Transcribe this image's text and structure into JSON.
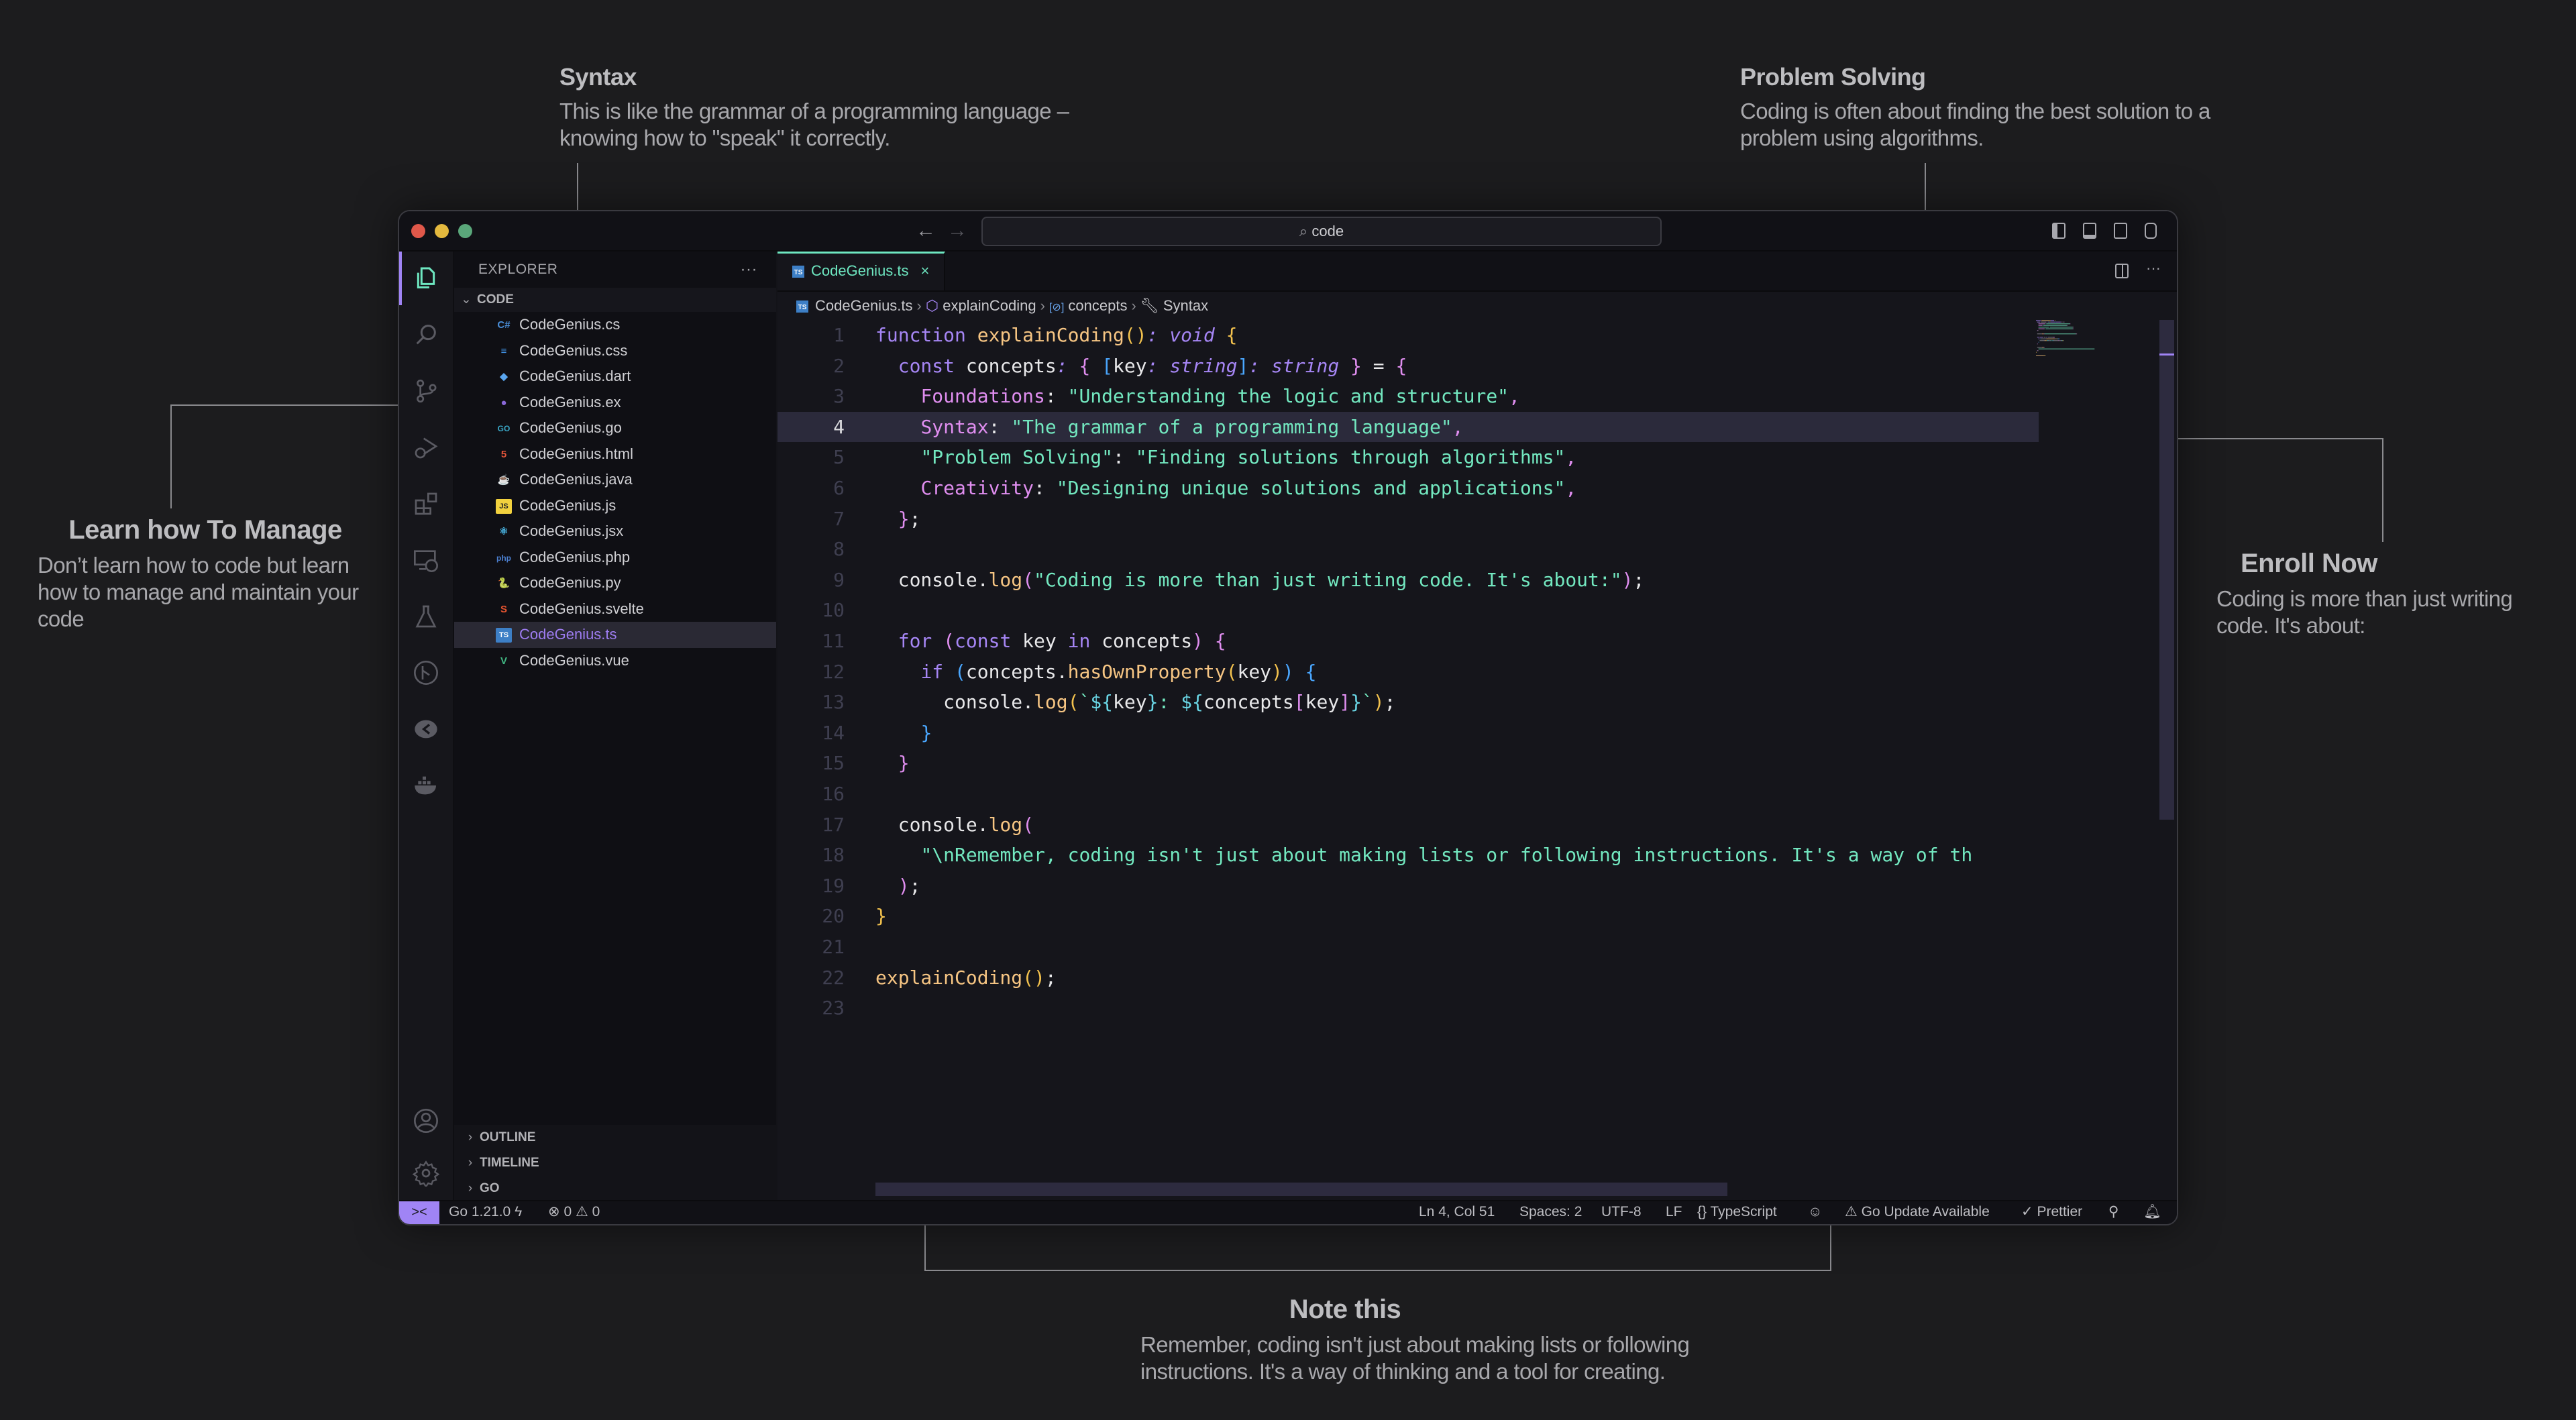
{
  "annotations": {
    "syntax": {
      "title": "Syntax",
      "body_line1": "This is like the grammar of a programming language –",
      "body_line2": "knowing how to \"speak\" it correctly."
    },
    "problem_solving": {
      "title": "Problem Solving",
      "body_line1": "Coding is often about finding the best solution to a",
      "body_line2": "problem using algorithms."
    },
    "learn": {
      "title": "Learn how To Manage",
      "body_line1": "Don’t learn how to code but learn",
      "body_line2": "how to manage and maintain your",
      "body_line3": "code"
    },
    "enroll": {
      "title": "Enroll Now",
      "body_line1": "Coding is more than just writing",
      "body_line2": "code. It's about:"
    },
    "note": {
      "title": "Note this",
      "body_line1": "Remember, coding isn't just about making lists or following",
      "body_line2": "instructions. It's a way of thinking and a tool for creating."
    }
  },
  "titlebar": {
    "search_text": "code",
    "search_icon": "search-icon",
    "back_icon": "arrow-left-icon",
    "forward_icon": "arrow-right-icon",
    "layout_icons": [
      "toggle-primary-sidebar-icon",
      "toggle-panel-icon",
      "toggle-secondary-sidebar-icon",
      "customize-layout-icon"
    ]
  },
  "activity_bar": {
    "items": [
      "explorer",
      "search",
      "source-control",
      "run-and-debug",
      "extensions",
      "remote-explorer",
      "testing",
      "git-graph",
      "live-share",
      "docker"
    ],
    "bottom": [
      "accounts",
      "manage"
    ]
  },
  "sidebar": {
    "title": "EXPLORER",
    "more": "···",
    "folder": "CODE",
    "files": [
      {
        "name": "CodeGenius.cs",
        "icon": "C#",
        "color": "#4a8fd9"
      },
      {
        "name": "CodeGenius.css",
        "icon": "≡",
        "color": "#3f8fe0"
      },
      {
        "name": "CodeGenius.dart",
        "icon": "◆",
        "color": "#5aa6f0"
      },
      {
        "name": "CodeGenius.ex",
        "icon": "●",
        "color": "#8a68d8"
      },
      {
        "name": "CodeGenius.go",
        "icon": "GO",
        "color": "#3aa8c8"
      },
      {
        "name": "CodeGenius.html",
        "icon": "5",
        "color": "#e4553a"
      },
      {
        "name": "CodeGenius.java",
        "icon": "☕",
        "color": "#e0553e"
      },
      {
        "name": "CodeGenius.js",
        "icon": "JS",
        "color": "#f2d13e"
      },
      {
        "name": "CodeGenius.jsx",
        "icon": "⚛",
        "color": "#4ab8e8"
      },
      {
        "name": "CodeGenius.php",
        "icon": "php",
        "color": "#4b7fd0"
      },
      {
        "name": "CodeGenius.py",
        "icon": "🐍",
        "color": "#f2c53d"
      },
      {
        "name": "CodeGenius.svelte",
        "icon": "S",
        "color": "#ea5530"
      },
      {
        "name": "CodeGenius.ts",
        "icon": "TS",
        "color": "#3d7fc6",
        "selected": true
      },
      {
        "name": "CodeGenius.vue",
        "icon": "V",
        "color": "#41b883"
      }
    ],
    "sections": [
      "OUTLINE",
      "TIMELINE",
      "GO"
    ]
  },
  "editor": {
    "tab": {
      "label": "CodeGenius.ts",
      "close": "×"
    },
    "breadcrumb": [
      "CodeGenius.ts",
      "explainCoding",
      "concepts",
      "Syntax"
    ],
    "current_line": 4,
    "lines": [
      [
        [
          "kw",
          "function "
        ],
        [
          "fn",
          "explainCoding"
        ],
        [
          "br1",
          "()"
        ],
        [
          "ty",
          ": void "
        ],
        [
          "br1",
          "{"
        ]
      ],
      [
        [
          "pl",
          "  "
        ],
        [
          "kw",
          "const "
        ],
        [
          "pl",
          "concepts"
        ],
        [
          "ty",
          ": "
        ],
        [
          "br2",
          "{ "
        ],
        [
          "br3",
          "["
        ],
        [
          "pl",
          "key"
        ],
        [
          "ty",
          ": string"
        ],
        [
          "br3",
          "]"
        ],
        [
          "ty",
          ": string "
        ],
        [
          "br2",
          "} "
        ],
        [
          "pl",
          "= "
        ],
        [
          "br2",
          "{"
        ]
      ],
      [
        [
          "pl",
          "    "
        ],
        [
          "prop",
          "Foundations"
        ],
        [
          "pl",
          ": "
        ],
        [
          "str",
          "\"Understanding the logic and structure\""
        ],
        [
          "pun",
          ","
        ]
      ],
      [
        [
          "pl",
          "    "
        ],
        [
          "prop",
          "Syntax"
        ],
        [
          "pl",
          ": "
        ],
        [
          "str",
          "\"The grammar of a programming language\""
        ],
        [
          "pun",
          ","
        ]
      ],
      [
        [
          "pl",
          "    "
        ],
        [
          "str",
          "\"Problem Solving\""
        ],
        [
          "pl",
          ": "
        ],
        [
          "str",
          "\"Finding solutions through algorithms\""
        ],
        [
          "pun",
          ","
        ]
      ],
      [
        [
          "pl",
          "    "
        ],
        [
          "prop",
          "Creativity"
        ],
        [
          "pl",
          ": "
        ],
        [
          "str",
          "\"Designing unique solutions and applications\""
        ],
        [
          "pun",
          ","
        ]
      ],
      [
        [
          "pl",
          "  "
        ],
        [
          "br2",
          "}"
        ],
        [
          "pl",
          ";"
        ]
      ],
      [],
      [
        [
          "pl",
          "  console."
        ],
        [
          "fn",
          "log"
        ],
        [
          "br2",
          "("
        ],
        [
          "str",
          "\"Coding is more than just writing code. It's about:\""
        ],
        [
          "br2",
          ")"
        ],
        [
          "pl",
          ";"
        ]
      ],
      [],
      [
        [
          "pl",
          "  "
        ],
        [
          "kw",
          "for "
        ],
        [
          "br2",
          "("
        ],
        [
          "kw",
          "const "
        ],
        [
          "pl",
          "key "
        ],
        [
          "kw",
          "in "
        ],
        [
          "pl",
          "concepts"
        ],
        [
          "br2",
          ") {"
        ]
      ],
      [
        [
          "pl",
          "    "
        ],
        [
          "kw",
          "if "
        ],
        [
          "br3",
          "("
        ],
        [
          "pl",
          "concepts."
        ],
        [
          "fn",
          "hasOwnProperty"
        ],
        [
          "br1",
          "("
        ],
        [
          "pl",
          "key"
        ],
        [
          "br1",
          ")"
        ],
        [
          "br3",
          ") {"
        ]
      ],
      [
        [
          "pl",
          "      console."
        ],
        [
          "fn",
          "log"
        ],
        [
          "br1",
          "("
        ],
        [
          "str",
          "`"
        ],
        [
          "tmpl",
          "${"
        ],
        [
          "pl",
          "key"
        ],
        [
          "tmpl",
          "}"
        ],
        [
          "str",
          ": "
        ],
        [
          "tmpl",
          "${"
        ],
        [
          "pl",
          "concepts"
        ],
        [
          "br2",
          "["
        ],
        [
          "pl",
          "key"
        ],
        [
          "br2",
          "]"
        ],
        [
          "tmpl",
          "}"
        ],
        [
          "str",
          "`"
        ],
        [
          "br1",
          ")"
        ],
        [
          "pl",
          ";"
        ]
      ],
      [
        [
          "pl",
          "    "
        ],
        [
          "br3",
          "}"
        ]
      ],
      [
        [
          "pl",
          "  "
        ],
        [
          "br2",
          "}"
        ]
      ],
      [],
      [
        [
          "pl",
          "  console."
        ],
        [
          "fn",
          "log"
        ],
        [
          "br2",
          "("
        ]
      ],
      [
        [
          "pl",
          "    "
        ],
        [
          "str",
          "\"\\nRemember, coding isn't just about making lists or following instructions. It's a way of th"
        ]
      ],
      [
        [
          "pl",
          "  "
        ],
        [
          "br2",
          ")"
        ],
        [
          "pl",
          ";"
        ]
      ],
      [
        [
          "br1",
          "}"
        ]
      ],
      [],
      [
        [
          "fn",
          "explainCoding"
        ],
        [
          "br1",
          "()"
        ],
        [
          "pl",
          ";"
        ]
      ],
      []
    ]
  },
  "statusbar": {
    "remote": "><",
    "go_version": "Go 1.21.0",
    "errors": "0",
    "warnings": "0",
    "position": "Ln 4, Col 51",
    "spaces": "Spaces: 2",
    "encoding": "UTF-8",
    "eol": "LF",
    "language": "TypeScript",
    "go_update": "Go Update Available",
    "prettier": "Prettier"
  }
}
